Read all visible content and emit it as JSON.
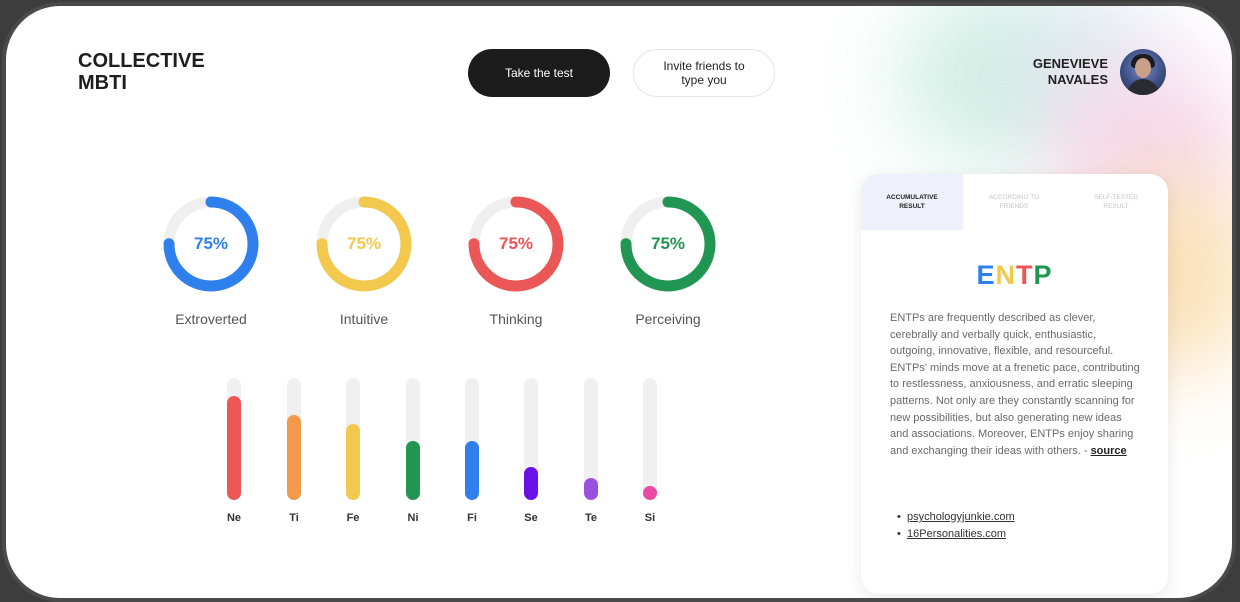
{
  "header": {
    "logo": "COLLECTIVE MBTI",
    "take_test": "Take the test",
    "invite": "Invite friends to type you",
    "user_name": "GENEVIEVE NAVALES"
  },
  "donuts": [
    {
      "label": "Extroverted",
      "percent": "75%",
      "value": 0.75,
      "color": "#2f80ed"
    },
    {
      "label": "Intuitive",
      "percent": "75%",
      "value": 0.75,
      "color": "#f2c94c"
    },
    {
      "label": "Thinking",
      "percent": "75%",
      "value": 0.75,
      "color": "#eb5757"
    },
    {
      "label": "Perceiving",
      "percent": "75%",
      "value": 0.75,
      "color": "#219653"
    }
  ],
  "functions": [
    {
      "label": "Ne",
      "level": 0.85,
      "color": "#eb5757"
    },
    {
      "label": "Ti",
      "level": 0.7,
      "color": "#f2994a"
    },
    {
      "label": "Fe",
      "level": 0.62,
      "color": "#f2c94c"
    },
    {
      "label": "Ni",
      "level": 0.48,
      "color": "#219653"
    },
    {
      "label": "Fi",
      "level": 0.48,
      "color": "#2f80ed"
    },
    {
      "label": "Se",
      "level": 0.27,
      "color": "#6a11e8"
    },
    {
      "label": "Te",
      "level": 0.18,
      "color": "#9b51e0"
    },
    {
      "label": "Si",
      "level": 0.08,
      "color": "#e84aa4"
    }
  ],
  "result": {
    "tabs": [
      "Accumulative result",
      "According to friends",
      "Self-tested result"
    ],
    "type_letters": [
      {
        "letter": "E",
        "color": "#2f80ed"
      },
      {
        "letter": "N",
        "color": "#f2c94c"
      },
      {
        "letter": "T",
        "color": "#eb5757"
      },
      {
        "letter": "P",
        "color": "#219653"
      }
    ],
    "description": "ENTPs are frequently described as clever, cerebrally and verbally quick, enthusiastic, outgoing, innovative, flexible, and resourceful. ENTPs' minds move at a frenetic pace, contributing to restlessness, anxiousness, and erratic sleeping patterns. Not only are they constantly scanning for new possibilities, but also generating new ideas and associations. Moreover, ENTPs enjoy sharing and exchanging their ideas with others. - ",
    "source": "source",
    "links": [
      "psychologyjunkie.com",
      "16Personalities.com"
    ]
  }
}
